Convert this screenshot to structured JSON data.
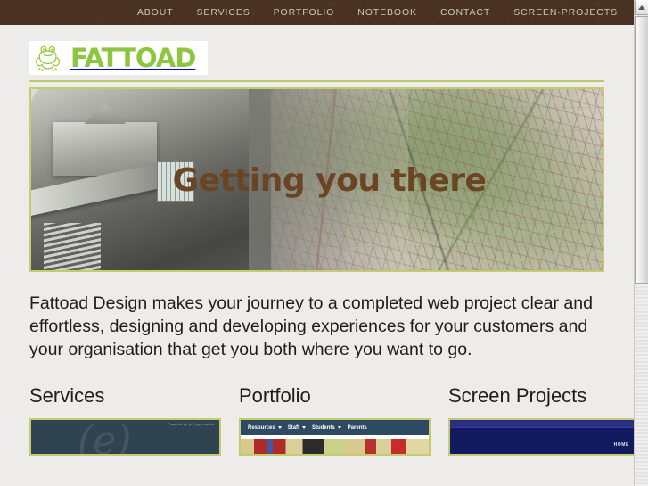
{
  "nav": {
    "items": [
      {
        "label": "ABOUT",
        "name": "nav-about"
      },
      {
        "label": "SERVICES",
        "name": "nav-services"
      },
      {
        "label": "PORTFOLIO",
        "name": "nav-portfolio"
      },
      {
        "label": "NOTEBOOK",
        "name": "nav-notebook"
      },
      {
        "label": "CONTACT",
        "name": "nav-contact"
      },
      {
        "label": "SCREEN-PROJECTS",
        "name": "nav-screen-projects"
      }
    ],
    "background_color": "#4a3222",
    "link_color": "#cdc5bc"
  },
  "logo": {
    "wordmark": "FATTOAD",
    "icon": "frog-icon",
    "color": "#8cc63e"
  },
  "hero": {
    "title": "Getting you there",
    "title_color": "#6b4423",
    "border_color": "#c5cc6e",
    "image_description": "grayscale railway station photo blended with ordnance survey topographic map"
  },
  "intro": {
    "text": "Fattoad Design makes your journey to a completed web project clear and effortless, designing and developing experiences for your customers and your organisation that get you both where you want to go."
  },
  "columns": [
    {
      "title": "Services",
      "name": "column-services",
      "thumb_name": "services-thumbnail",
      "thumb_watermark": "(e)",
      "thumb_caption": "Powered by (e) hypermedia"
    },
    {
      "title": "Portfolio",
      "name": "column-portfolio",
      "thumb_name": "portfolio-thumbnail",
      "thumb_nav": [
        {
          "label": "Resources",
          "caret": true
        },
        {
          "label": "Staff",
          "caret": true
        },
        {
          "label": "Students",
          "caret": true
        },
        {
          "label": "Parents",
          "caret": false
        }
      ]
    },
    {
      "title": "Screen Projects",
      "name": "column-screen-projects",
      "thumb_name": "screen-projects-thumbnail",
      "thumb_label": "HOME"
    }
  ],
  "scrollbar": {
    "up_arrow": "scroll-up-arrow"
  }
}
